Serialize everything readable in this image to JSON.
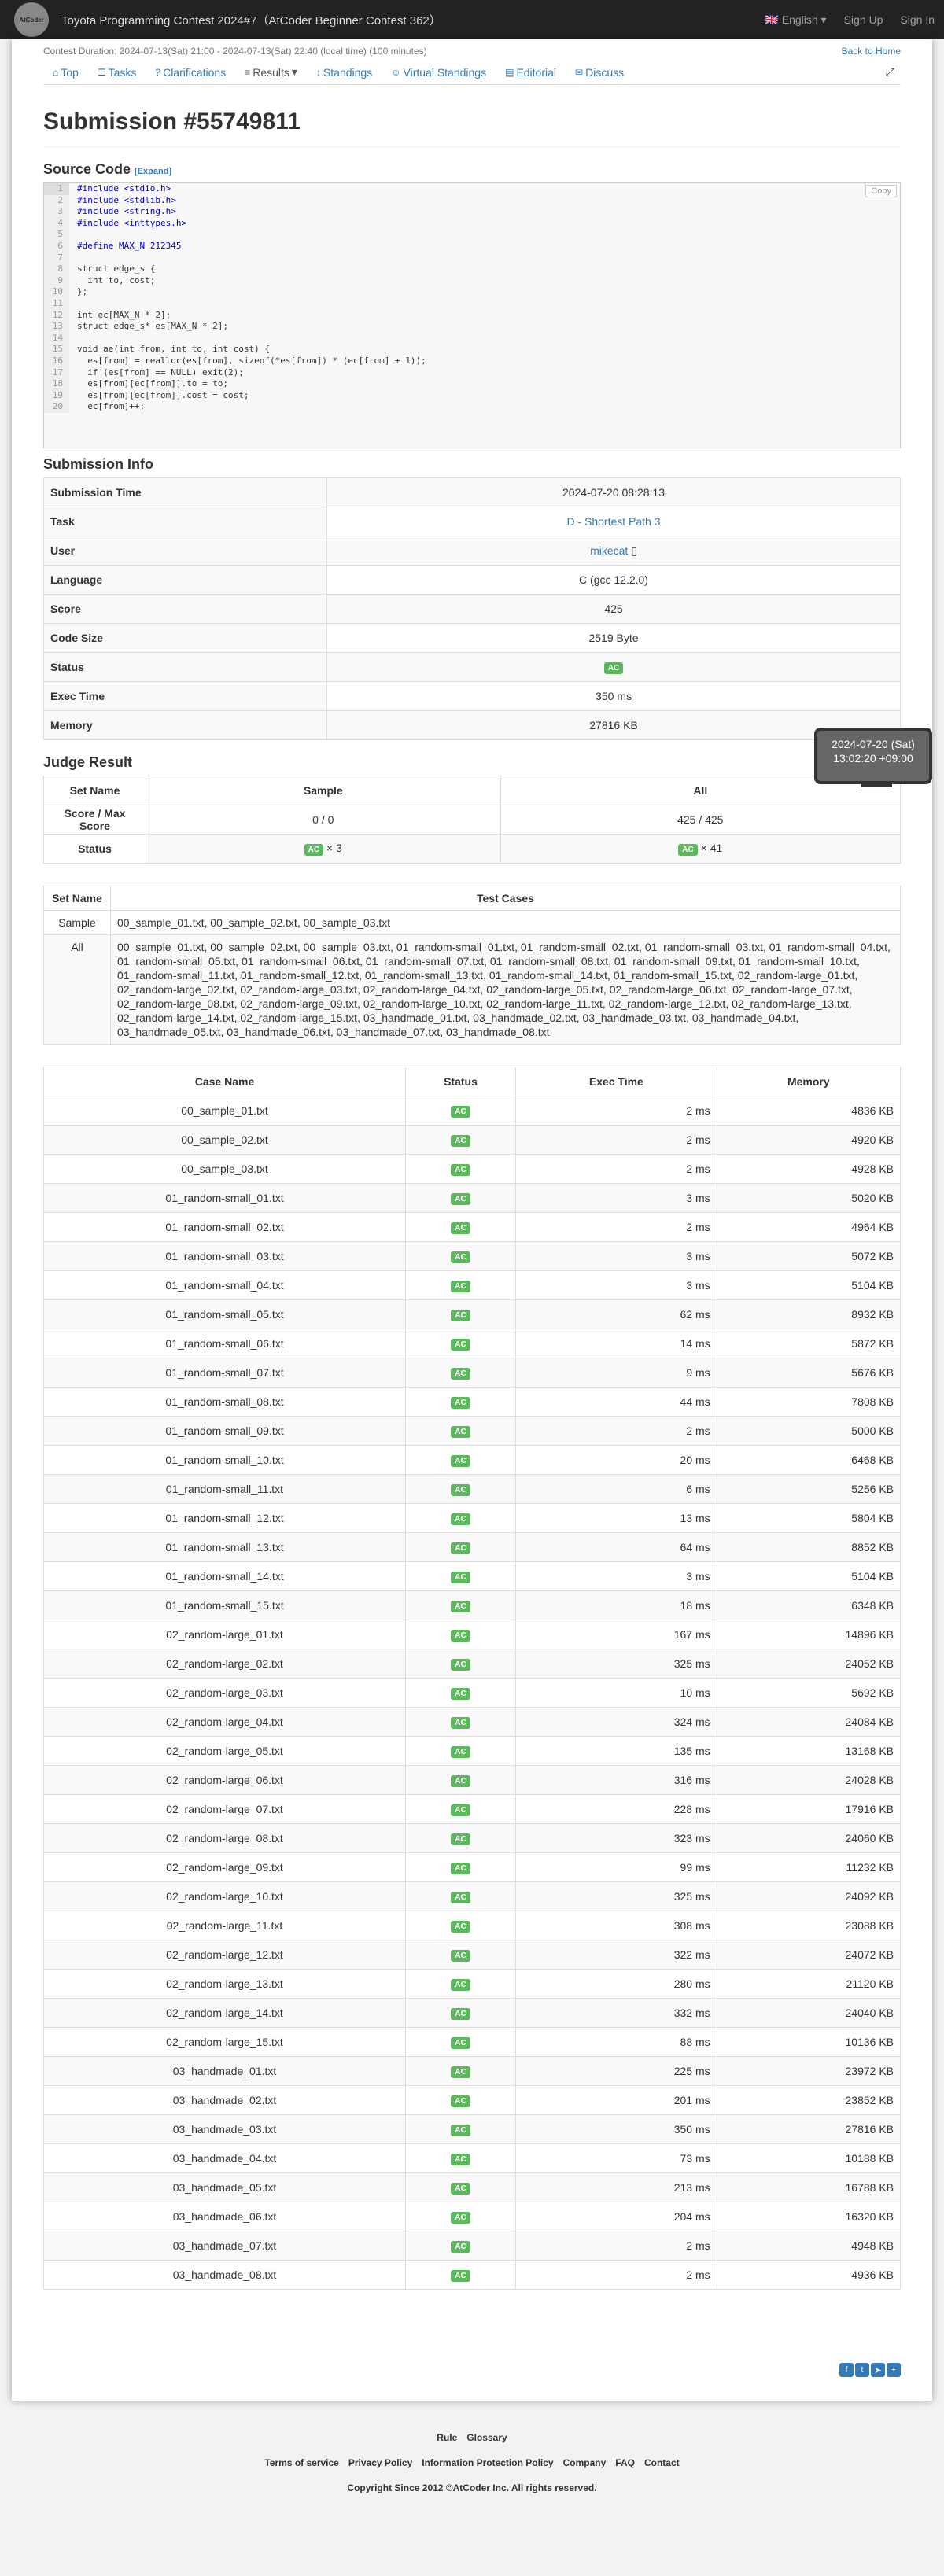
{
  "nav": {
    "title": "Toyota Programming Contest 2024#7（AtCoder Beginner Contest 362）",
    "language": "English",
    "signup": "Sign Up",
    "signin": "Sign In",
    "logo": "AtCoder"
  },
  "contest": {
    "duration": "Contest Duration: 2024-07-13(Sat) 21:00 - 2024-07-13(Sat) 22:40 (local time) (100 minutes)",
    "back_home": "Back to Home"
  },
  "tabs": [
    {
      "label": "Top",
      "icon": "home-icon"
    },
    {
      "label": "Tasks",
      "icon": "tasks-icon"
    },
    {
      "label": "Clarifications",
      "icon": "question-icon"
    },
    {
      "label": "Results",
      "icon": "list-icon"
    },
    {
      "label": "Standings",
      "icon": "sort-icon"
    },
    {
      "label": "Virtual Standings",
      "icon": "users-icon"
    },
    {
      "label": "Editorial",
      "icon": "book-icon"
    },
    {
      "label": "Discuss",
      "icon": "comment-icon"
    }
  ],
  "page_title": "Submission #55749811",
  "source": {
    "heading": "Source Code",
    "expand": "[Expand]",
    "copy": "Copy",
    "lines": [
      "#include <stdio.h>",
      "#include <stdlib.h>",
      "#include <string.h>",
      "#include <inttypes.h>",
      "",
      "#define MAX_N 212345",
      "",
      "struct edge_s {",
      "  int to, cost;",
      "};",
      "",
      "int ec[MAX_N * 2];",
      "struct edge_s* es[MAX_N * 2];",
      "",
      "void ae(int from, int to, int cost) {",
      "  es[from] = realloc(es[from], sizeof(*es[from]) * (ec[from] + 1));",
      "  if (es[from] == NULL) exit(2);",
      "  es[from][ec[from]].to = to;",
      "  es[from][ec[from]].cost = cost;",
      "  ec[from]++;"
    ]
  },
  "info": {
    "heading": "Submission Info",
    "rows": [
      {
        "k": "Submission Time",
        "v": "2024-07-20 08:28:13"
      },
      {
        "k": "Task",
        "v": "D - Shortest Path 3"
      },
      {
        "k": "User",
        "v": "mikecat"
      },
      {
        "k": "Language",
        "v": "C (gcc 12.2.0)"
      },
      {
        "k": "Score",
        "v": "425"
      },
      {
        "k": "Code Size",
        "v": "2519 Byte"
      },
      {
        "k": "Status",
        "v": "AC"
      },
      {
        "k": "Exec Time",
        "v": "350 ms"
      },
      {
        "k": "Memory",
        "v": "27816 KB"
      }
    ]
  },
  "tooltip": {
    "line1": "2024-07-20 (Sat)",
    "line2": "13:02:20 +09:00"
  },
  "judge": {
    "heading": "Judge Result",
    "set_name": "Set Name",
    "sample": "Sample",
    "all": "All",
    "score_label": "Score / Max Score",
    "sample_score": "0 / 0",
    "all_score": "425 / 425",
    "status_label": "Status",
    "sample_status": "× 3",
    "all_status": "× 41",
    "ac": "AC"
  },
  "sets": {
    "set_name": "Set Name",
    "test_cases": "Test Cases",
    "sample_key": "Sample",
    "sample_val": "00_sample_01.txt, 00_sample_02.txt, 00_sample_03.txt",
    "all_key": "All",
    "all_val": "00_sample_01.txt, 00_sample_02.txt, 00_sample_03.txt, 01_random-small_01.txt, 01_random-small_02.txt, 01_random-small_03.txt, 01_random-small_04.txt, 01_random-small_05.txt, 01_random-small_06.txt, 01_random-small_07.txt, 01_random-small_08.txt, 01_random-small_09.txt, 01_random-small_10.txt, 01_random-small_11.txt, 01_random-small_12.txt, 01_random-small_13.txt, 01_random-small_14.txt, 01_random-small_15.txt, 02_random-large_01.txt, 02_random-large_02.txt, 02_random-large_03.txt, 02_random-large_04.txt, 02_random-large_05.txt, 02_random-large_06.txt, 02_random-large_07.txt, 02_random-large_08.txt, 02_random-large_09.txt, 02_random-large_10.txt, 02_random-large_11.txt, 02_random-large_12.txt, 02_random-large_13.txt, 02_random-large_14.txt, 02_random-large_15.txt, 03_handmade_01.txt, 03_handmade_02.txt, 03_handmade_03.txt, 03_handmade_04.txt, 03_handmade_05.txt, 03_handmade_06.txt, 03_handmade_07.txt, 03_handmade_08.txt"
  },
  "cases": {
    "headers": [
      "Case Name",
      "Status",
      "Exec Time",
      "Memory"
    ],
    "rows": [
      [
        "00_sample_01.txt",
        "AC",
        "2 ms",
        "4836 KB"
      ],
      [
        "00_sample_02.txt",
        "AC",
        "2 ms",
        "4920 KB"
      ],
      [
        "00_sample_03.txt",
        "AC",
        "2 ms",
        "4928 KB"
      ],
      [
        "01_random-small_01.txt",
        "AC",
        "3 ms",
        "5020 KB"
      ],
      [
        "01_random-small_02.txt",
        "AC",
        "2 ms",
        "4964 KB"
      ],
      [
        "01_random-small_03.txt",
        "AC",
        "3 ms",
        "5072 KB"
      ],
      [
        "01_random-small_04.txt",
        "AC",
        "3 ms",
        "5104 KB"
      ],
      [
        "01_random-small_05.txt",
        "AC",
        "62 ms",
        "8932 KB"
      ],
      [
        "01_random-small_06.txt",
        "AC",
        "14 ms",
        "5872 KB"
      ],
      [
        "01_random-small_07.txt",
        "AC",
        "9 ms",
        "5676 KB"
      ],
      [
        "01_random-small_08.txt",
        "AC",
        "44 ms",
        "7808 KB"
      ],
      [
        "01_random-small_09.txt",
        "AC",
        "2 ms",
        "5000 KB"
      ],
      [
        "01_random-small_10.txt",
        "AC",
        "20 ms",
        "6468 KB"
      ],
      [
        "01_random-small_11.txt",
        "AC",
        "6 ms",
        "5256 KB"
      ],
      [
        "01_random-small_12.txt",
        "AC",
        "13 ms",
        "5804 KB"
      ],
      [
        "01_random-small_13.txt",
        "AC",
        "64 ms",
        "8852 KB"
      ],
      [
        "01_random-small_14.txt",
        "AC",
        "3 ms",
        "5104 KB"
      ],
      [
        "01_random-small_15.txt",
        "AC",
        "18 ms",
        "6348 KB"
      ],
      [
        "02_random-large_01.txt",
        "AC",
        "167 ms",
        "14896 KB"
      ],
      [
        "02_random-large_02.txt",
        "AC",
        "325 ms",
        "24052 KB"
      ],
      [
        "02_random-large_03.txt",
        "AC",
        "10 ms",
        "5692 KB"
      ],
      [
        "02_random-large_04.txt",
        "AC",
        "324 ms",
        "24084 KB"
      ],
      [
        "02_random-large_05.txt",
        "AC",
        "135 ms",
        "13168 KB"
      ],
      [
        "02_random-large_06.txt",
        "AC",
        "316 ms",
        "24028 KB"
      ],
      [
        "02_random-large_07.txt",
        "AC",
        "228 ms",
        "17916 KB"
      ],
      [
        "02_random-large_08.txt",
        "AC",
        "323 ms",
        "24060 KB"
      ],
      [
        "02_random-large_09.txt",
        "AC",
        "99 ms",
        "11232 KB"
      ],
      [
        "02_random-large_10.txt",
        "AC",
        "325 ms",
        "24092 KB"
      ],
      [
        "02_random-large_11.txt",
        "AC",
        "308 ms",
        "23088 KB"
      ],
      [
        "02_random-large_12.txt",
        "AC",
        "322 ms",
        "24072 KB"
      ],
      [
        "02_random-large_13.txt",
        "AC",
        "280 ms",
        "21120 KB"
      ],
      [
        "02_random-large_14.txt",
        "AC",
        "332 ms",
        "24040 KB"
      ],
      [
        "02_random-large_15.txt",
        "AC",
        "88 ms",
        "10136 KB"
      ],
      [
        "03_handmade_01.txt",
        "AC",
        "225 ms",
        "23972 KB"
      ],
      [
        "03_handmade_02.txt",
        "AC",
        "201 ms",
        "23852 KB"
      ],
      [
        "03_handmade_03.txt",
        "AC",
        "350 ms",
        "27816 KB"
      ],
      [
        "03_handmade_04.txt",
        "AC",
        "73 ms",
        "10188 KB"
      ],
      [
        "03_handmade_05.txt",
        "AC",
        "213 ms",
        "16788 KB"
      ],
      [
        "03_handmade_06.txt",
        "AC",
        "204 ms",
        "16320 KB"
      ],
      [
        "03_handmade_07.txt",
        "AC",
        "2 ms",
        "4948 KB"
      ],
      [
        "03_handmade_08.txt",
        "AC",
        "2 ms",
        "4936 KB"
      ]
    ]
  },
  "footer": {
    "row1": [
      "Rule",
      "Glossary"
    ],
    "row2": [
      "Terms of service",
      "Privacy Policy",
      "Information Protection Policy",
      "Company",
      "FAQ",
      "Contact"
    ],
    "copyright": "Copyright Since 2012 ©AtCoder Inc. All rights reserved."
  }
}
